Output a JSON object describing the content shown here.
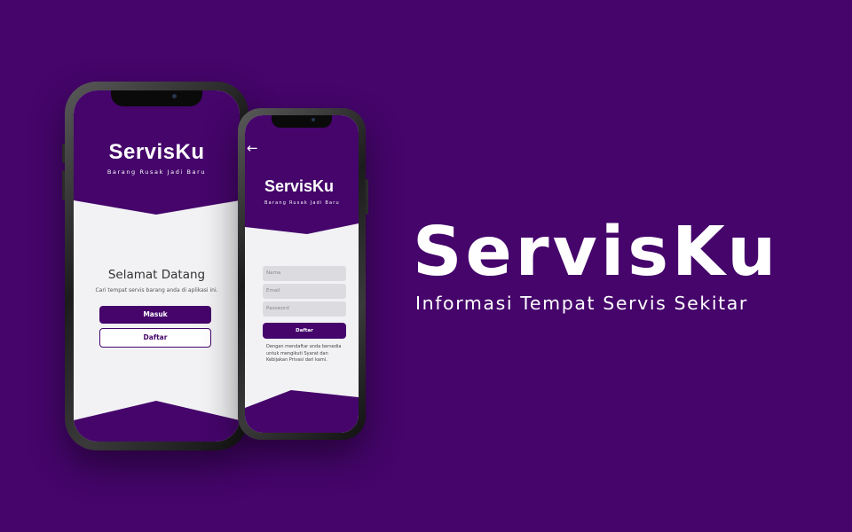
{
  "colors": {
    "background": "#45056b",
    "screen_bg": "#f2f2f4",
    "field_bg": "#dcdce0"
  },
  "hero": {
    "title": "ServisKu",
    "subtitle": "Informasi Tempat Servis Sekitar"
  },
  "phone_login": {
    "logo": "ServisKu",
    "tagline": "Barang Rusak Jadi Baru",
    "welcome": "Selamat Datang",
    "description": "Cari tempat servis barang anda di aplikasi ini.",
    "login_label": "Masuk",
    "register_label": "Daftar"
  },
  "phone_register": {
    "back_icon": "arrow-left-icon",
    "logo": "ServisKu",
    "tagline": "Barang Rusak Jadi Baru",
    "name_placeholder": "Nama",
    "email_placeholder": "Email",
    "password_placeholder": "Password",
    "register_label": "Daftar",
    "terms_text": "Dengan mendaftar anda bersedia untuk mengikuti Syarat dan Kebijakan Privasi dari kami."
  }
}
